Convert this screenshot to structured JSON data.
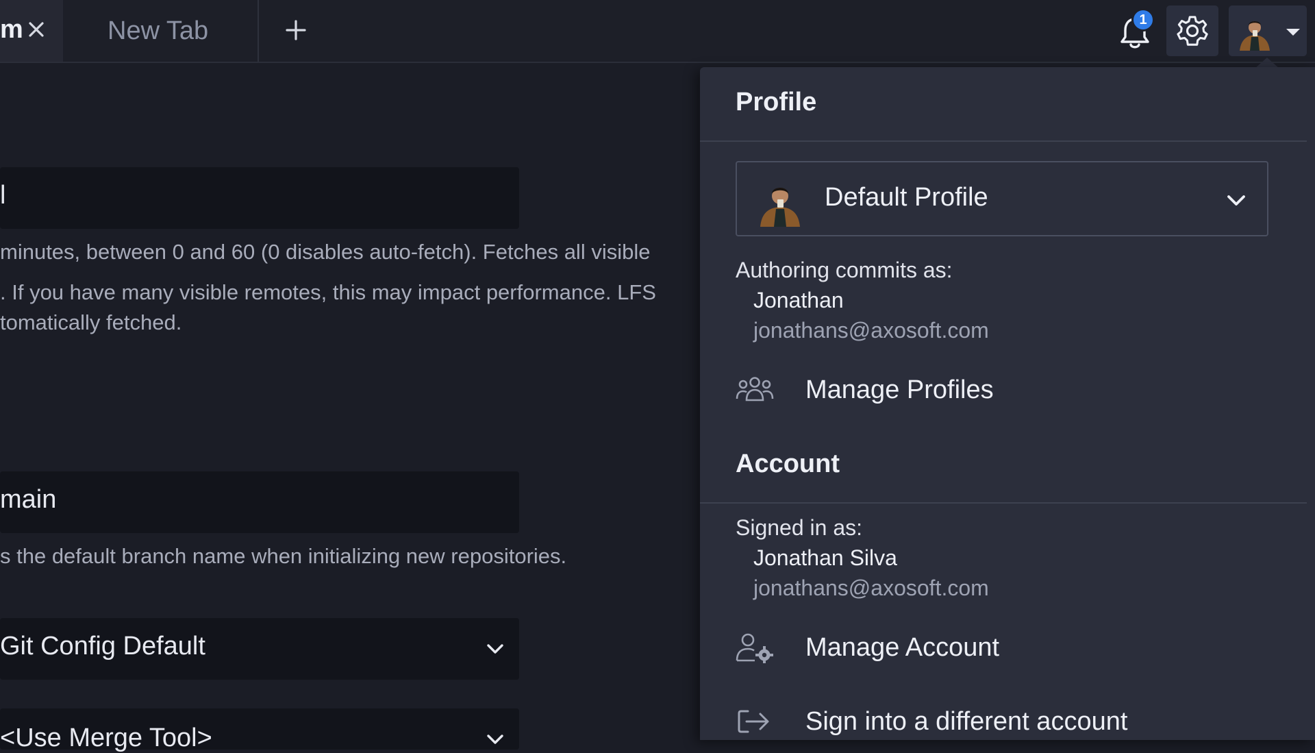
{
  "tabs": {
    "active_label": "m",
    "new_tab_label": "New Tab"
  },
  "header": {
    "notification_count": "1"
  },
  "settings": {
    "autofetch_value": "l",
    "autofetch_help_line1": "minutes, between 0 and 60 (0 disables auto-fetch). Fetches all visible",
    "autofetch_help_line2": ". If you have many visible remotes, this may impact performance. LFS",
    "autofetch_help_line3": "tomatically fetched.",
    "default_branch_value": "main",
    "default_branch_help": "s the default branch name when initializing new repositories.",
    "gpg_select_value": "Git Config Default",
    "merge_tool_value": "<Use Merge Tool>"
  },
  "profile_menu": {
    "profile_section_title": "Profile",
    "selected_profile": "Default Profile",
    "authoring_label": "Authoring commits as:",
    "author_name": "Jonathan",
    "author_email": "jonathans@axosoft.com",
    "manage_profiles_label": "Manage Profiles",
    "account_section_title": "Account",
    "signed_in_label": "Signed in as:",
    "account_name": "Jonathan Silva",
    "account_email": "jonathans@axosoft.com",
    "manage_account_label": "Manage Account",
    "sign_into_different_label": "Sign into a different account"
  },
  "icons": {
    "close": "close-icon",
    "add_tab": "plus-icon",
    "notifications": "bell-icon",
    "settings": "gear-icon",
    "avatar": "avatar",
    "manage_profiles": "users-icon",
    "manage_account": "user-gear-icon",
    "sign_in": "sign-in-icon"
  },
  "colors": {
    "background": "#1b1d26",
    "panel": "#2b2e3b",
    "badge": "#2f7ce8",
    "input_bg": "#12141b"
  }
}
